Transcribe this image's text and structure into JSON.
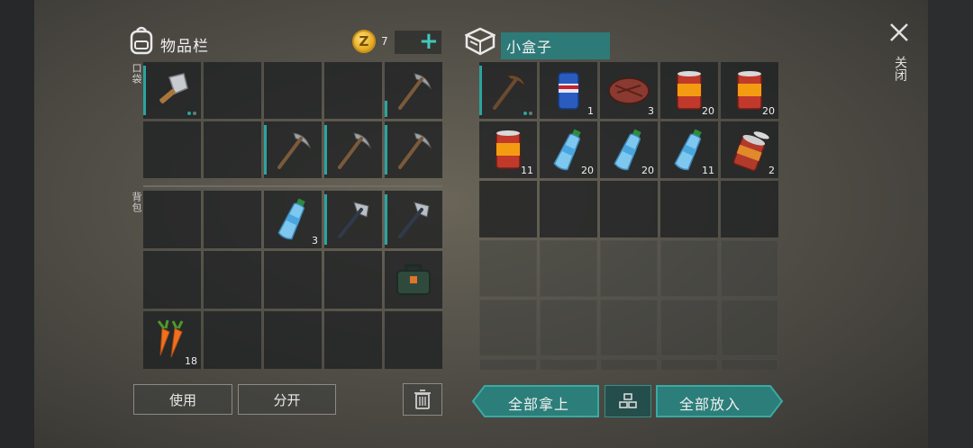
{
  "inventory": {
    "title": "物品栏",
    "coins": "7",
    "coin_symbol": "Z",
    "pocket_label": "口袋",
    "backpack_label": "背包",
    "pocket_slots": [
      {
        "item": "cleaver",
        "count": "",
        "dots": true,
        "bar": true
      },
      {
        "item": "",
        "count": ""
      },
      {
        "item": "",
        "count": ""
      },
      {
        "item": "",
        "count": ""
      },
      {
        "item": "pickaxe",
        "count": "",
        "bar": true,
        "barShort": true
      },
      {
        "item": "",
        "count": ""
      },
      {
        "item": "",
        "count": ""
      },
      {
        "item": "pickaxe",
        "count": "",
        "bar": true
      },
      {
        "item": "pickaxe",
        "count": "",
        "bar": true
      },
      {
        "item": "pickaxe",
        "count": "",
        "bar": true
      }
    ],
    "backpack_slots": [
      {
        "item": "",
        "count": ""
      },
      {
        "item": "",
        "count": ""
      },
      {
        "item": "water-bottle",
        "count": "3"
      },
      {
        "item": "hatchet",
        "count": "",
        "bar": true
      },
      {
        "item": "hatchet",
        "count": "",
        "bar": true
      },
      {
        "item": "",
        "count": ""
      },
      {
        "item": "",
        "count": ""
      },
      {
        "item": "",
        "count": ""
      },
      {
        "item": "",
        "count": ""
      },
      {
        "item": "toolbox",
        "count": ""
      },
      {
        "item": "carrots",
        "count": "18"
      },
      {
        "item": "",
        "count": ""
      },
      {
        "item": "",
        "count": ""
      },
      {
        "item": "",
        "count": ""
      },
      {
        "item": "",
        "count": ""
      }
    ],
    "use_label": "使用",
    "split_label": "分开"
  },
  "box": {
    "title": "小盒子",
    "slots": [
      {
        "item": "pickaxe-dark",
        "count": "",
        "dots": true,
        "bar": true
      },
      {
        "item": "soda-can",
        "count": "1"
      },
      {
        "item": "steak",
        "count": "3"
      },
      {
        "item": "food-can",
        "count": "20"
      },
      {
        "item": "food-can",
        "count": "20"
      },
      {
        "item": "food-can",
        "count": "11"
      },
      {
        "item": "water-bottle",
        "count": "20"
      },
      {
        "item": "water-bottle",
        "count": "20"
      },
      {
        "item": "water-bottle",
        "count": "11"
      },
      {
        "item": "open-can",
        "count": "2"
      }
    ],
    "take_all_label": "全部拿上",
    "put_all_label": "全部放入"
  },
  "close_label": "关闭",
  "colors": {
    "accent_teal": "#2aa5a0",
    "button_teal": "#2b7e7a"
  }
}
